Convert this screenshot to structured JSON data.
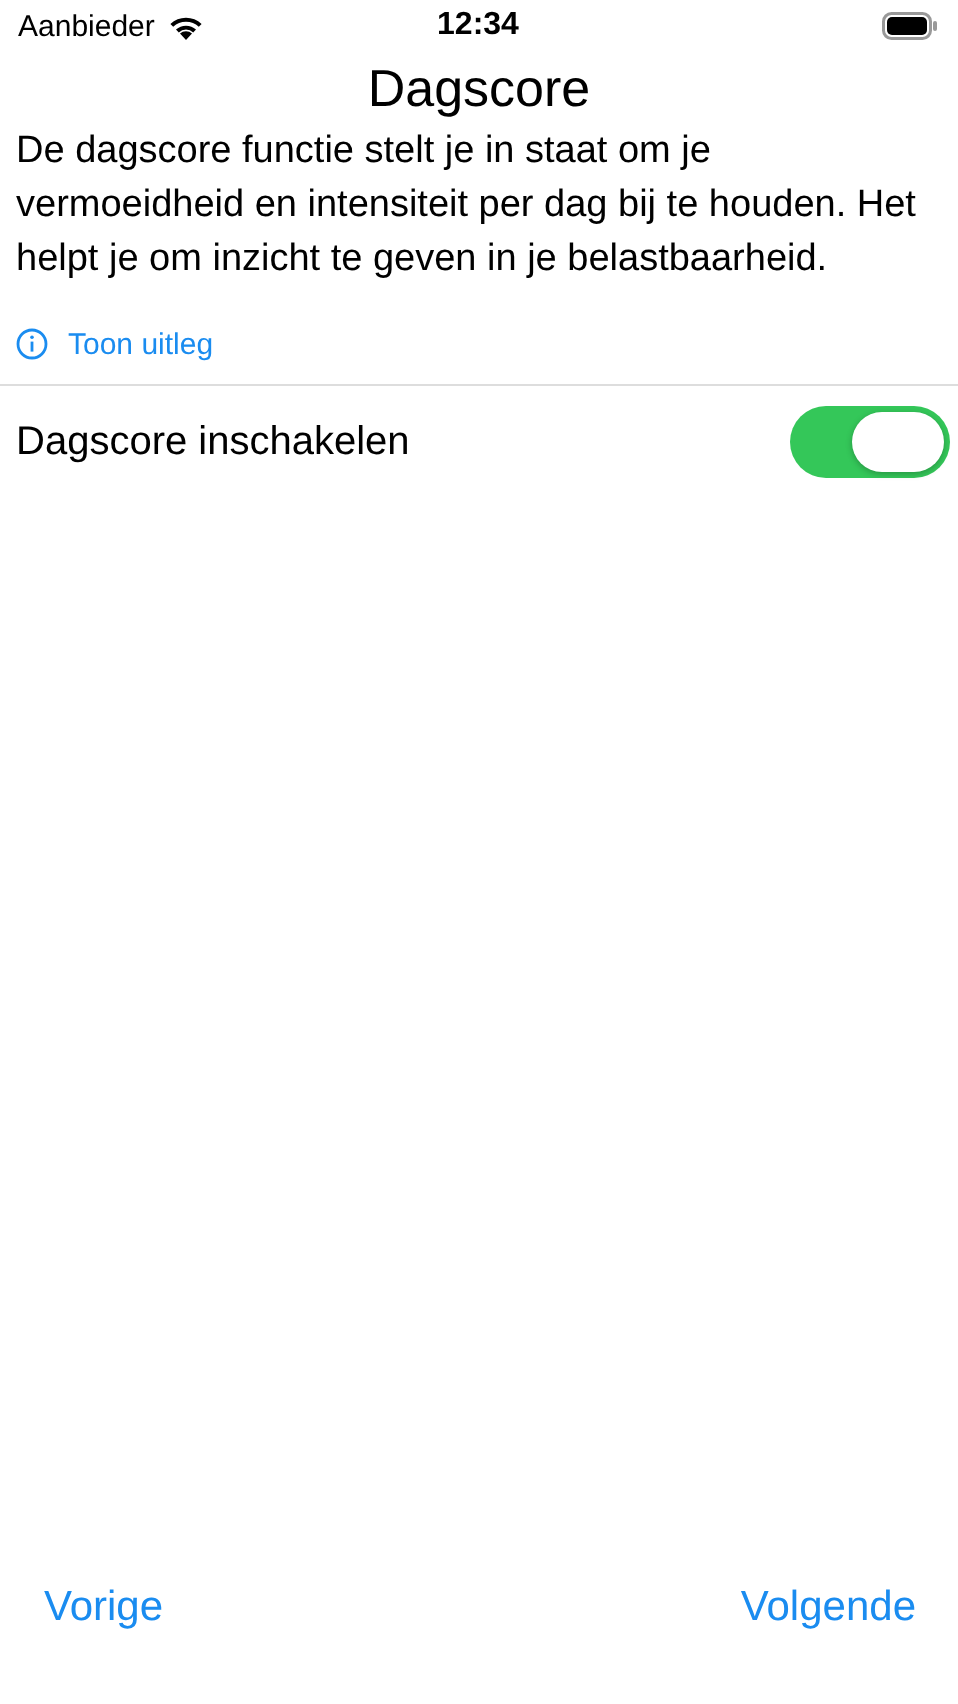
{
  "status_bar": {
    "carrier": "Aanbieder",
    "time": "12:34"
  },
  "title": "Dagscore",
  "description": "De dagscore functie stelt je in staat om je vermoeidheid en intensiteit per dag bij te houden. Het helpt je om inzicht te geven in je belastbaarheid.",
  "info_link": "Toon uitleg",
  "setting": {
    "label": "Dagscore inschakelen",
    "on": true
  },
  "nav": {
    "back": "Vorige",
    "next": "Volgende"
  }
}
